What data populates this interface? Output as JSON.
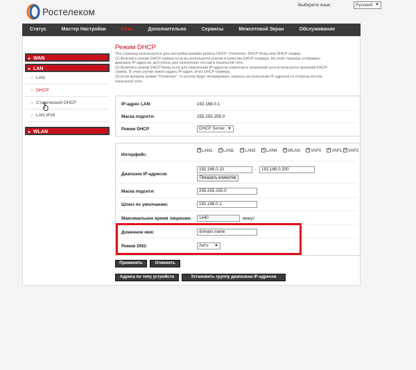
{
  "header": {
    "brand": "Ростелеком",
    "language_label": "Выберите язык:",
    "language_value": "Русский"
  },
  "nav": [
    {
      "label": "Статус"
    },
    {
      "label": "Мастер Настройки"
    },
    {
      "label": "Сеть"
    },
    {
      "label": "Дополнительно"
    },
    {
      "label": "Сервисы"
    },
    {
      "label": "Межсетевой Экран"
    },
    {
      "label": "Обслуживание"
    }
  ],
  "sidebar": {
    "wan": "WAN",
    "lan": "LAN",
    "items": [
      {
        "label": "LAN"
      },
      {
        "label": "DHCP"
      },
      {
        "label": "Статический DHCP"
      },
      {
        "label": "LAN IPv6"
      }
    ],
    "wlan": "WLAN"
  },
  "page": {
    "title": "Режим DHCP",
    "description": [
      "Эта страница используется для настройки режима работы DHCP: Отключен, DHCP Relay или DHCP-сервер.",
      "(1) Включите режим DHCP-сервер если вы используете роутер в качестве DHCP-сервера. На этой странице отображен",
      "диапазон IP-адресов, доступных для назначения хостам в локальной сети.",
      "(2) Включите режим DHCP Relay если для назначения IP-адресов клиентам в локальной сети используется внешний DHCP-",
      "сервер. В этом случае нужно задать IP-адрес этого DHCP-сервера.",
      "(3) Если выбрать режим \"Отключен\", то роутер будет игнорировать запросы на получение IP-адресов со стороны хостов",
      "локальной сети."
    ]
  },
  "lan_info": {
    "ip_label": "IP-адрес LAN:",
    "ip_value": "192.168.0.1",
    "mask_label": "Маска подсети:",
    "mask_value": "255.255.255.0",
    "mode_label": "Режим DHCP",
    "mode_value": "DHCP Server"
  },
  "dhcp": {
    "interface_label": "Интерфейс:",
    "interfaces": [
      "LAN1",
      "LAN2",
      "LAN3",
      "LAN4",
      "WLAN",
      "VAP0",
      "VAP1",
      "VAP2"
    ],
    "range_label": "Диапазон IP-адресов",
    "range_start": "192.168.0.10",
    "range_dash": "-",
    "range_end": "192.168.0.200",
    "show_clients": "Показать клиентов",
    "mask_label": "Маска подсети:",
    "mask_value": "255.255.255.0",
    "gateway_label": "Шлюз по умолчанию:",
    "gateway_value": "192.168.0.1",
    "lease_label": "Максимальное время лицензии:",
    "lease_value": "1440",
    "lease_unit": "минут",
    "domain_label": "Доменное имя:",
    "domain_value": "domain.name",
    "dns_label": "Режим DNS:",
    "dns_value": "Авто"
  },
  "buttons": {
    "apply": "Применить",
    "cancel": "Отменить",
    "by_device": "Адреса по типу устройств",
    "set_group": "Установить группу диапазона IP-адресов"
  },
  "colors": {
    "brand_red": "#c8101c",
    "highlight_red": "#e0101e",
    "nav_dark": "#3a3a3a"
  }
}
